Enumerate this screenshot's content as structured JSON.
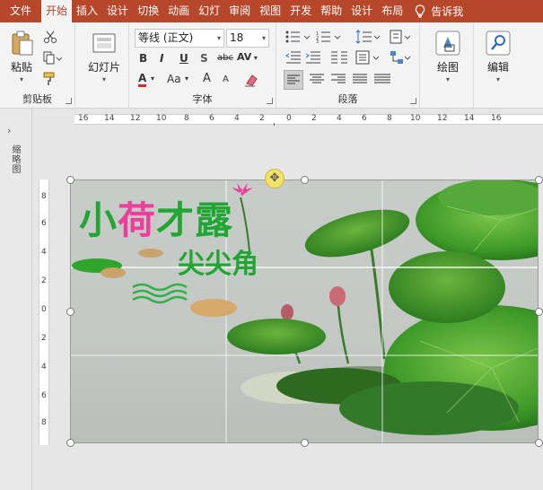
{
  "tabs": [
    "文件",
    "开始",
    "插入",
    "设计",
    "切换",
    "动画",
    "幻灯",
    "审阅",
    "视图",
    "开发",
    "帮助",
    "设计",
    "布局"
  ],
  "tell_me": "告诉我",
  "ribbon": {
    "clipboard": {
      "paste": "粘贴",
      "label": "剪贴板"
    },
    "slides": {
      "new_slide": "幻灯片"
    },
    "font": {
      "name": "等线 (正文)",
      "size": "18",
      "label": "字体",
      "bold": "B",
      "italic": "I",
      "underline": "U",
      "shadow": "S",
      "strike": "abc",
      "spacing": "AV",
      "font_color": "A",
      "case": "Aa",
      "grow": "A",
      "shrink": "A"
    },
    "paragraph": {
      "label": "段落"
    },
    "drawing": {
      "label": "绘图"
    },
    "editing": {
      "label": "编辑"
    }
  },
  "left_pane": {
    "label": "缩略图"
  },
  "hruler_labels": [
    "16",
    "14",
    "12",
    "10",
    "8",
    "6",
    "4",
    "2",
    "0",
    "2",
    "4",
    "6",
    "8",
    "10",
    "12",
    "14",
    "16"
  ],
  "vruler_labels": [
    "8",
    "6",
    "4",
    "2",
    "0",
    "2",
    "4",
    "6",
    "8"
  ],
  "slide": {
    "title": "小荷才露",
    "subtitle": "尖尖角",
    "colors": {
      "title_green": "#22a633",
      "title_pink": "#ec3f9c",
      "lotus_leaf": "#3f9a2b",
      "background": "#c9cdc9"
    }
  },
  "colors": {
    "accent": "#b7472a",
    "ribbon_bg": "#f3f3f3"
  }
}
